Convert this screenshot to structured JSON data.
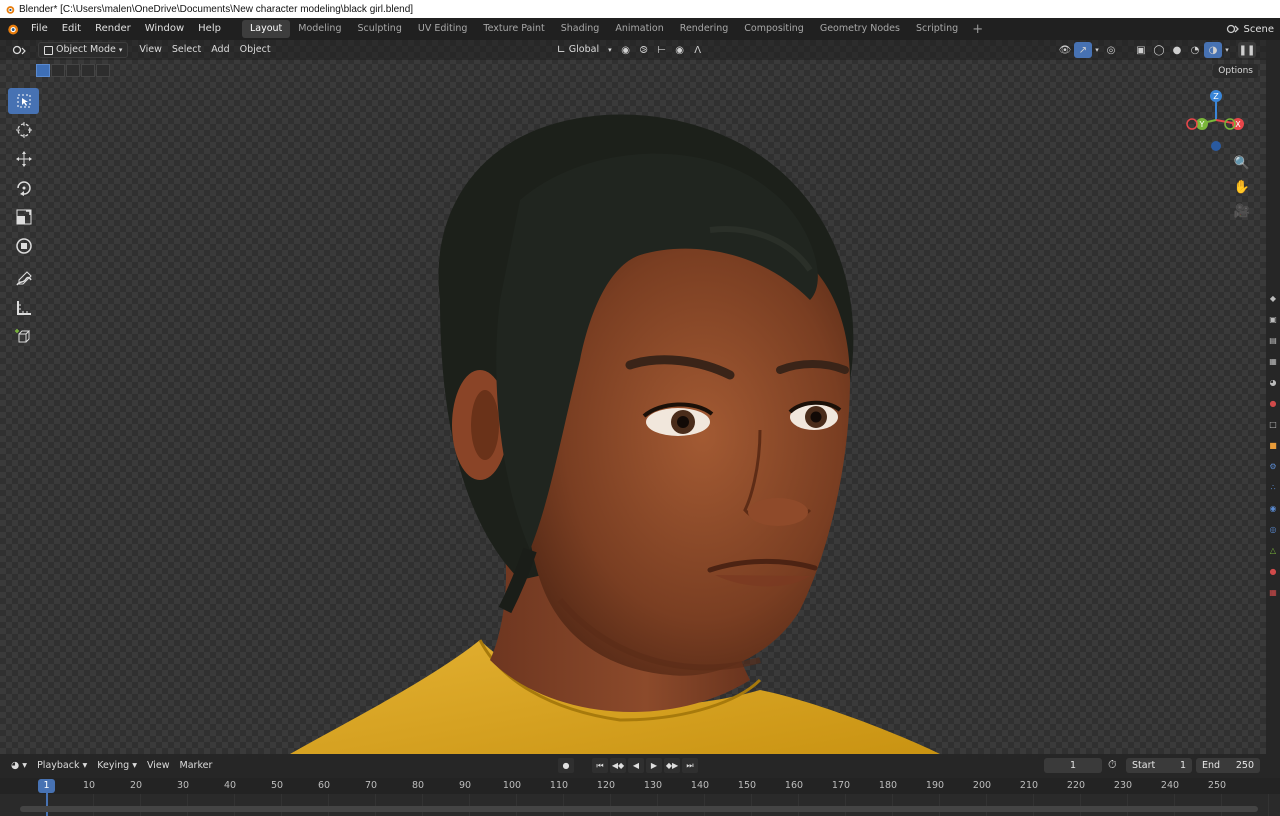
{
  "window": {
    "title": "Blender* [C:\\Users\\malen\\OneDrive\\Documents\\New character modeling\\black girl.blend]"
  },
  "menubar": {
    "menus": [
      "File",
      "Edit",
      "Render",
      "Window",
      "Help"
    ],
    "workspaces": [
      "Layout",
      "Modeling",
      "Sculpting",
      "UV Editing",
      "Texture Paint",
      "Shading",
      "Animation",
      "Rendering",
      "Compositing",
      "Geometry Nodes",
      "Scripting"
    ],
    "active_workspace": "Layout",
    "add_workspace": "+",
    "scene": "Scene"
  },
  "viewport_header": {
    "mode": "Object Mode",
    "menus": [
      "View",
      "Select",
      "Add",
      "Object"
    ],
    "transform_orientation": "Global",
    "options": "Options"
  },
  "tools": [
    {
      "name": "select-box",
      "icon": "select-box-icon",
      "active": true
    },
    {
      "name": "cursor",
      "icon": "cursor-icon",
      "active": false
    },
    {
      "name": "move",
      "icon": "move-icon",
      "active": false
    },
    {
      "name": "rotate",
      "icon": "rotate-icon",
      "active": false
    },
    {
      "name": "scale",
      "icon": "scale-icon",
      "active": false
    },
    {
      "name": "transform",
      "icon": "transform-icon",
      "active": false
    },
    {
      "name": "annotate",
      "icon": "annotate-icon",
      "active": false
    },
    {
      "name": "measure",
      "icon": "measure-icon",
      "active": false
    },
    {
      "name": "add-cube",
      "icon": "add-cube-icon",
      "active": false
    }
  ],
  "gizmo": {
    "x": "X",
    "y": "Y",
    "z": "Z"
  },
  "colors": {
    "accent": "#4772b3",
    "axis_x": "#e8464a",
    "axis_y": "#7ab73a",
    "axis_z": "#3a86d8",
    "shirt": "#d9a51c",
    "skin": "#8a4a2a",
    "hair": "#1e221c"
  },
  "timeline": {
    "menus": [
      "Playback",
      "Keying",
      "View",
      "Marker"
    ],
    "current_frame": "1",
    "start_label": "Start",
    "start": "1",
    "end_label": "End",
    "end": "250",
    "ticks": [
      "10",
      "20",
      "30",
      "40",
      "50",
      "60",
      "70",
      "80",
      "90",
      "100",
      "110",
      "120",
      "130",
      "140",
      "150",
      "160",
      "170",
      "180",
      "190",
      "200",
      "210",
      "220",
      "230",
      "240",
      "250"
    ]
  }
}
